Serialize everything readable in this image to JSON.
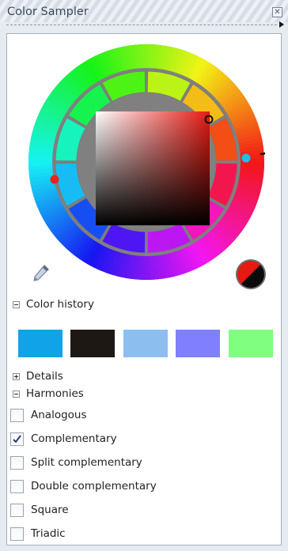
{
  "window": {
    "title": "Color Sampler",
    "close_icon": "close-icon"
  },
  "wheel": {
    "selected_color": "#e51a13",
    "saturation_value_hue": "#e51a13"
  },
  "tools": {
    "eyedropper_icon": "eyedropper-icon"
  },
  "preview": {
    "current_color": "#e51a13",
    "previous_color": "#0a0a0a"
  },
  "color_history": {
    "label": "Color history",
    "swatches": [
      "#11a3e8",
      "#1d1814",
      "#8cbff0",
      "#8080fe",
      "#80fe80"
    ]
  },
  "details": {
    "label": "Details"
  },
  "harmonies": {
    "label": "Harmonies",
    "options": [
      {
        "label": "Analogous",
        "checked": false
      },
      {
        "label": "Complementary",
        "checked": true
      },
      {
        "label": "Split complementary",
        "checked": false
      },
      {
        "label": "Double complementary",
        "checked": false
      },
      {
        "label": "Square",
        "checked": false
      },
      {
        "label": "Triadic",
        "checked": false
      }
    ]
  }
}
